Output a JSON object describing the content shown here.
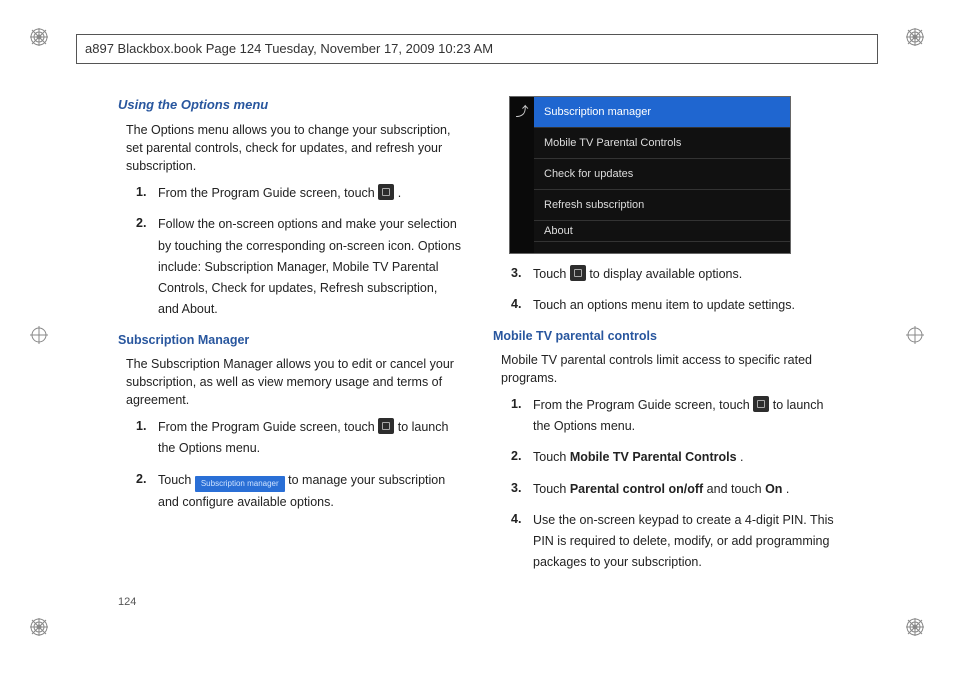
{
  "header": {
    "runningHead": "a897 Blackbox.book  Page 124  Tuesday, November 17, 2009  10:23 AM"
  },
  "pageNumber": "124",
  "left": {
    "h1": "Using the Options menu",
    "intro": "The Options menu allows you to change your subscription, set parental controls, check for updates, and refresh your subscription.",
    "steps1": {
      "n1": "1.",
      "t1a": "From the Program Guide screen, touch ",
      "t1b": ".",
      "n2": "2.",
      "t2": "Follow the on-screen options and make your selection by touching the corresponding on-screen icon. Options include: Subscription Manager, Mobile TV Parental Controls, Check for updates, Refresh subscription, and About."
    },
    "h2": "Subscription Manager",
    "intro2": "The Subscription Manager allows you to edit or cancel your subscription, as well as view memory usage and terms of agreement.",
    "steps2": {
      "n1": "1.",
      "t1a": "From the Program Guide screen, touch ",
      "t1b": " to launch the Options menu.",
      "n2": "2.",
      "t2a": "Touch ",
      "btn": "Subscription manager",
      "t2b": " to manage your subscription and configure available options."
    }
  },
  "right": {
    "phone": {
      "back": "⤴",
      "r1": "Subscription manager",
      "r2": "Mobile TV Parental Controls",
      "r3": "Check for updates",
      "r4": "Refresh subscription",
      "r5": "About"
    },
    "stepsA": {
      "n3": "3.",
      "t3a": "Touch ",
      "t3b": " to display available options.",
      "n4": "4.",
      "t4": "Touch an options menu item to update settings."
    },
    "h3": "Mobile TV parental controls",
    "intro3": "Mobile TV parental controls limit access to specific rated programs.",
    "stepsB": {
      "n1": "1.",
      "t1a": "From the Program Guide screen, touch ",
      "t1b": " to launch the Options menu.",
      "n2": "2.",
      "t2a": "Touch ",
      "b2": "Mobile TV Parental Controls",
      "t2b": ".",
      "n3": "3.",
      "t3a": "Touch ",
      "b3a": "Parental control on/off",
      "t3b": " and touch ",
      "b3b": "On",
      "t3c": ".",
      "n4": "4.",
      "t4": "Use the on-screen keypad to create a 4-digit PIN. This PIN is required to delete, modify, or add programming packages to your subscription."
    }
  }
}
